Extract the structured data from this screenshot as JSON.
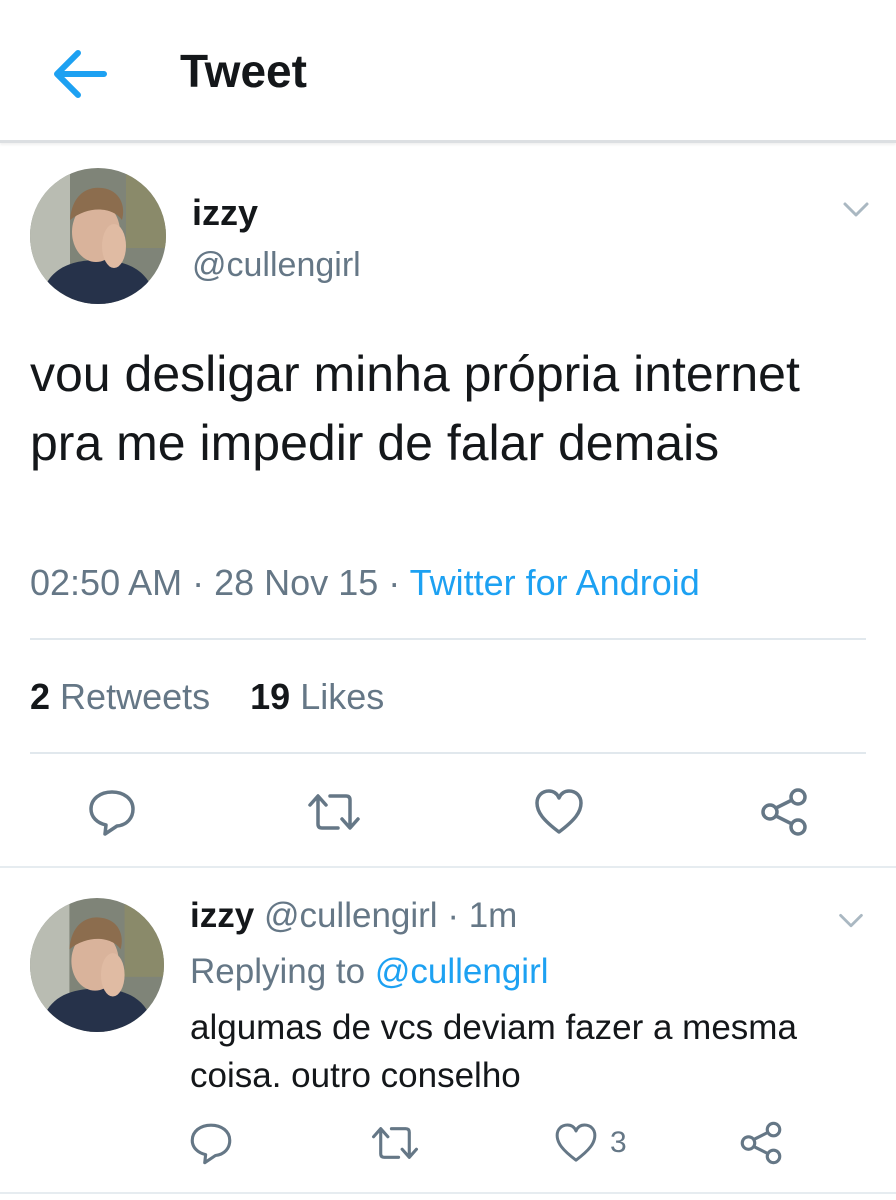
{
  "header": {
    "title": "Tweet",
    "back_icon": "arrow-left-icon"
  },
  "colors": {
    "accent": "#1da1f2",
    "secondary_text": "#657786",
    "primary_text": "#14171a",
    "divider": "#e1e8ed"
  },
  "tweet": {
    "name": "izzy",
    "handle": "@cullengirl",
    "text": "vou desligar minha própria internet pra me impedir de falar demais",
    "time": "02:50 AM",
    "date": "28 Nov 15",
    "source": "Twitter for Android",
    "separator": "·",
    "retweets_count": "2",
    "retweets_label": "Retweets",
    "likes_count": "19",
    "likes_label": "Likes"
  },
  "reply": {
    "name": "izzy",
    "handle": "@cullengirl",
    "separator": "·",
    "time": "1m",
    "replying_label": "Replying to",
    "replying_to": "@cullengirl",
    "text": "algumas de vcs deviam fazer a mesma coisa. outro conselho",
    "likes_count": "3"
  }
}
